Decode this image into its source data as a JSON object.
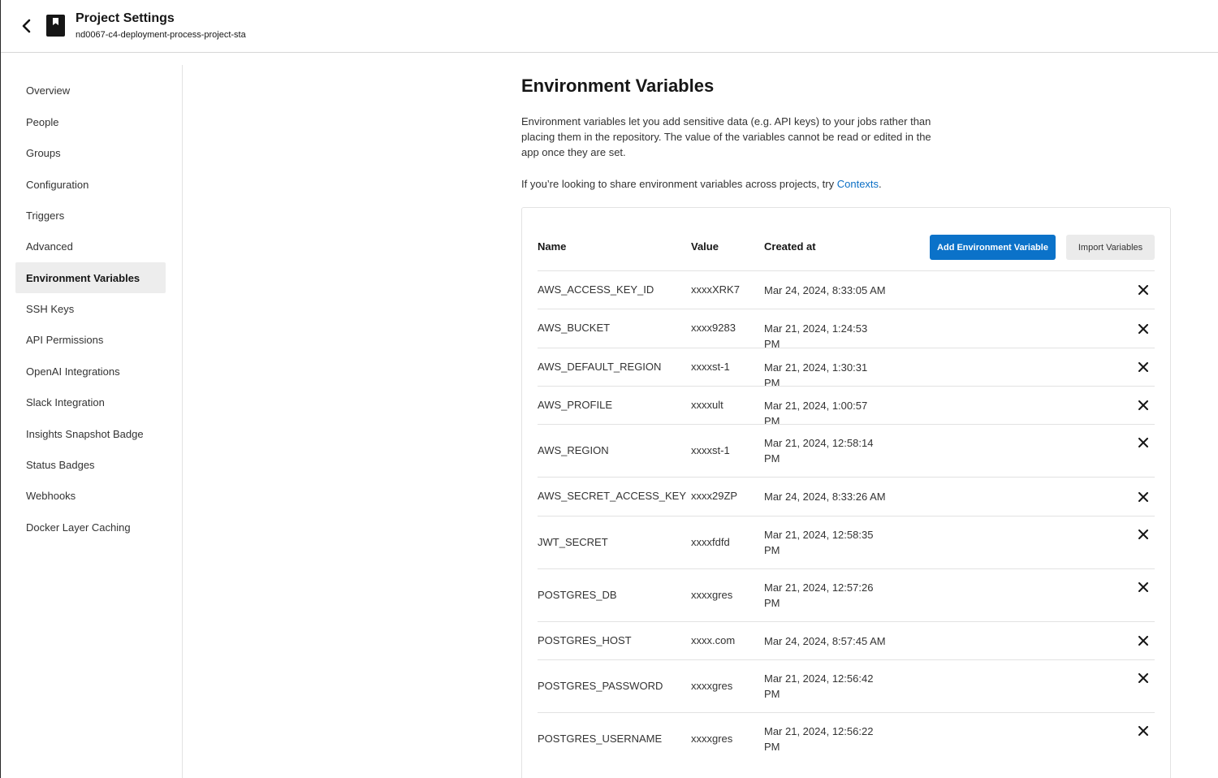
{
  "header": {
    "title": "Project Settings",
    "subtitle": "nd0067-c4-deployment-process-project-sta",
    "back_icon": "chevron-left-icon",
    "project_icon": "bookmark-icon"
  },
  "sidebar": {
    "items": [
      {
        "label": "Overview"
      },
      {
        "label": "People"
      },
      {
        "label": "Groups"
      },
      {
        "label": "Configuration"
      },
      {
        "label": "Triggers"
      },
      {
        "label": "Advanced"
      },
      {
        "label": "Environment Variables",
        "active": true
      },
      {
        "label": "SSH Keys"
      },
      {
        "label": "API Permissions"
      },
      {
        "label": "OpenAI Integrations"
      },
      {
        "label": "Slack Integration"
      },
      {
        "label": "Insights Snapshot Badge"
      },
      {
        "label": "Status Badges"
      },
      {
        "label": "Webhooks"
      },
      {
        "label": "Docker Layer Caching"
      }
    ]
  },
  "main": {
    "title": "Environment Variables",
    "description": "Environment variables let you add sensitive data (e.g. API keys) to your jobs rather than placing them in the repository. The value of the variables cannot be read or edited in the app once they are set.",
    "share_text": "If you’re looking to share environment variables across projects, try ",
    "share_link": "Contexts",
    "share_end": "."
  },
  "table": {
    "columns": {
      "name": "Name",
      "value": "Value",
      "created": "Created at"
    },
    "add_button": "Add Environment Variable",
    "import_button": "Import Variables",
    "delete_icon": "close-icon",
    "rows": [
      {
        "name": "AWS_ACCESS_KEY_ID",
        "value": "xxxxXRK7",
        "created": "Mar 24, 2024, 8:33:05 AM"
      },
      {
        "name": "AWS_BUCKET",
        "value": "xxxx9283",
        "created": "Mar 21, 2024, 1:24:53 PM"
      },
      {
        "name": "AWS_DEFAULT_REGION",
        "value": "xxxxst-1",
        "created": "Mar 21, 2024, 1:30:31 PM"
      },
      {
        "name": "AWS_PROFILE",
        "value": "xxxxult",
        "created": "Mar 21, 2024, 1:00:57 PM"
      },
      {
        "name": "AWS_REGION",
        "value": "xxxxst-1",
        "created": "Mar 21, 2024, 12:58:14 PM"
      },
      {
        "name": "AWS_SECRET_ACCESS_KEY",
        "value": "xxxx29ZP",
        "created": "Mar 24, 2024, 8:33:26 AM"
      },
      {
        "name": "JWT_SECRET",
        "value": "xxxxfdfd",
        "created": "Mar 21, 2024, 12:58:35 PM"
      },
      {
        "name": "POSTGRES_DB",
        "value": "xxxxgres",
        "created": "Mar 21, 2024, 12:57:26 PM"
      },
      {
        "name": "POSTGRES_HOST",
        "value": "xxxx.com",
        "created": "Mar 24, 2024, 8:57:45 AM"
      },
      {
        "name": "POSTGRES_PASSWORD",
        "value": "xxxxgres",
        "created": "Mar 21, 2024, 12:56:42 PM"
      },
      {
        "name": "POSTGRES_USERNAME",
        "value": "xxxxgres",
        "created": "Mar 21, 2024, 12:56:22 PM"
      }
    ]
  },
  "colors": {
    "primary": "#0b72c9",
    "link": "#0b6fc5",
    "active_nav_bg": "#ededed"
  }
}
